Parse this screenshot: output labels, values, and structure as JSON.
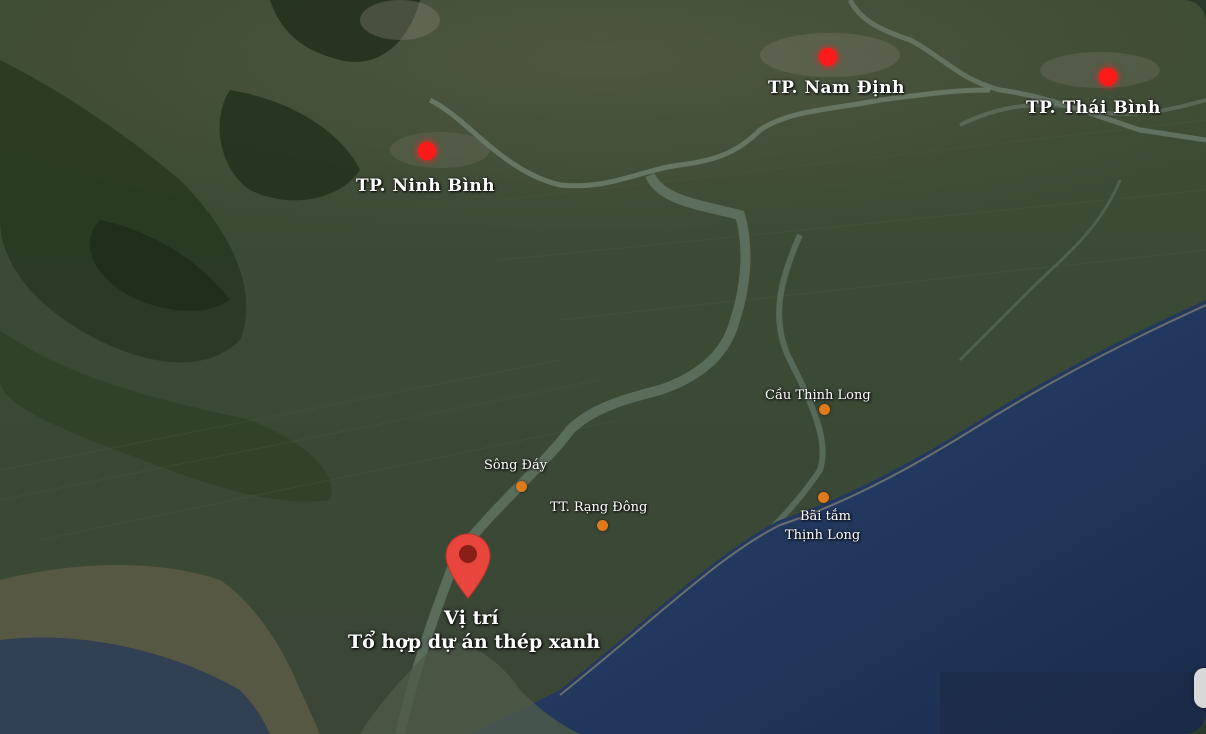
{
  "map": {
    "cities": [
      {
        "id": "ninh-binh",
        "label": "TP. Ninh Bình"
      },
      {
        "id": "nam-dinh",
        "label": "TP. Nam Định"
      },
      {
        "id": "thai-binh",
        "label": "TP. Thái Bình"
      }
    ],
    "pois": [
      {
        "id": "cau-thinh-long",
        "label": "Cầu Thịnh Long"
      },
      {
        "id": "song-day",
        "label": "Sông Đáy"
      },
      {
        "id": "tt-rang-dong",
        "label": "TT. Rạng Đông"
      },
      {
        "id": "bai-tam-line1",
        "label": "Bãi tắm"
      },
      {
        "id": "bai-tam-line2",
        "label": "Thịnh Long"
      }
    ],
    "project": {
      "line1": "Vị trí",
      "line2": "Tổ hợp dự án thép xanh"
    },
    "colors": {
      "city_marker": "#ff1a1a",
      "poi_marker": "#e07a1a",
      "pin": "#e8453c",
      "sea": "#1d3358",
      "land": "#3e5236"
    }
  }
}
